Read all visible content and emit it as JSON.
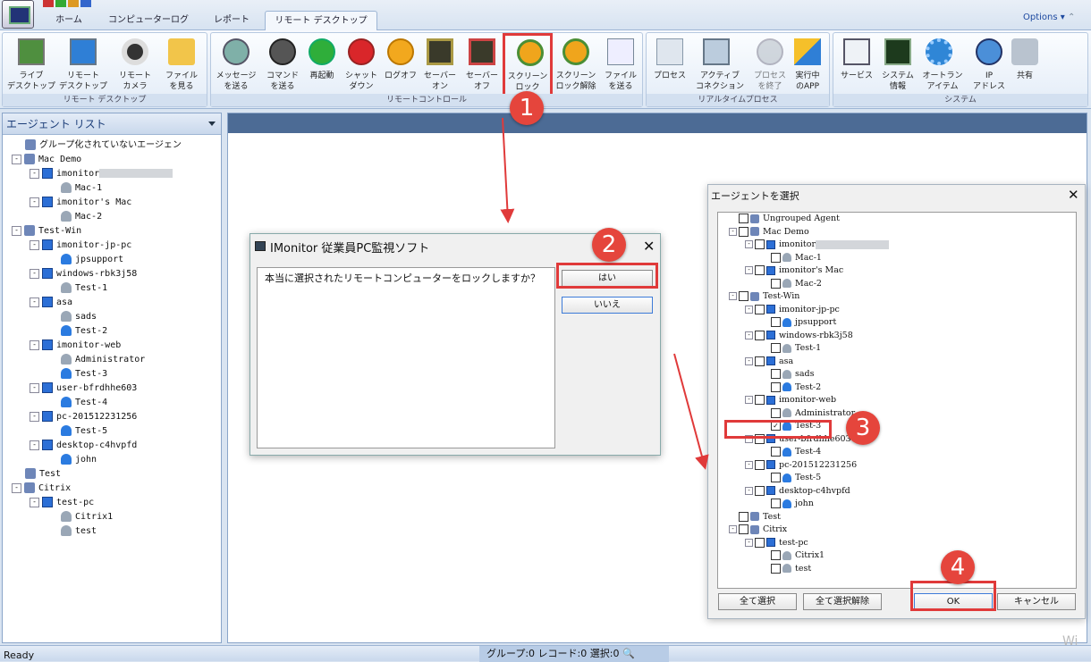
{
  "tabs": [
    "ホーム",
    "コンピューターログ",
    "レポート",
    "リモート デスクトップ"
  ],
  "options_label": "Options",
  "ribbon": {
    "groups": [
      {
        "title": "リモート デスクトップ",
        "buttons": [
          {
            "label": "ライブ\nデスクトップ",
            "icon": "monitor-icon"
          },
          {
            "label": "リモート\nデスクトップ",
            "icon": "remote-desktop-icon"
          },
          {
            "label": "リモート\nカメラ",
            "icon": "webcam-icon"
          },
          {
            "label": "ファイル\nを見る",
            "icon": "folder-icon"
          }
        ]
      },
      {
        "title": "リモートコントロール",
        "buttons": [
          {
            "label": "メッセージ\nを送る",
            "icon": "message-icon"
          },
          {
            "label": "コマンド\nを送る",
            "icon": "command-icon"
          },
          {
            "label": "再起動",
            "icon": "restart-icon"
          },
          {
            "label": "シャット\nダウン",
            "icon": "power-icon"
          },
          {
            "label": "ログオフ",
            "icon": "key-icon"
          },
          {
            "label": "セーバー\nオン",
            "icon": "screensaver-on-icon"
          },
          {
            "label": "セーバー\nオフ",
            "icon": "screensaver-off-icon"
          },
          {
            "label": "スクリーン\nロック",
            "icon": "screen-lock-icon"
          },
          {
            "label": "スクリーン\nロック解除",
            "icon": "screen-unlock-icon"
          },
          {
            "label": "ファイル\nを送る",
            "icon": "send-file-icon"
          }
        ]
      },
      {
        "title": "リアルタイムプロセス",
        "buttons": [
          {
            "label": "プロセス",
            "icon": "process-icon"
          },
          {
            "label": "アクティブ\nコネクション",
            "icon": "network-icon"
          },
          {
            "label": "プロセス\nを終了",
            "icon": "kill-process-icon"
          },
          {
            "label": "実行中\nのAPP",
            "icon": "apps-icon"
          }
        ]
      },
      {
        "title": "システム",
        "buttons": [
          {
            "label": "サービス",
            "icon": "services-icon"
          },
          {
            "label": "システム\n情報",
            "icon": "system-info-icon"
          },
          {
            "label": "オートラン\nアイテム",
            "icon": "gear-icon"
          },
          {
            "label": "IP\nアドレス",
            "icon": "ip-icon"
          },
          {
            "label": "共有",
            "icon": "share-icon"
          }
        ]
      }
    ]
  },
  "agent_panel": {
    "title": "エージェント リスト",
    "tree": [
      {
        "level": 0,
        "type": "grp",
        "text": "グループ化されていないエージェン",
        "toggle": ""
      },
      {
        "level": 0,
        "type": "grp",
        "text": "Mac Demo",
        "toggle": "-"
      },
      {
        "level": 1,
        "type": "pc",
        "text": "imonitor",
        "toggle": "-",
        "blur": true
      },
      {
        "level": 2,
        "type": "usr",
        "text": "Mac-1",
        "toggle": ""
      },
      {
        "level": 1,
        "type": "pc",
        "text": "imonitor's Mac",
        "toggle": "-"
      },
      {
        "level": 2,
        "type": "usr",
        "text": "Mac-2",
        "toggle": ""
      },
      {
        "level": 0,
        "type": "grp",
        "text": "Test-Win",
        "toggle": "-"
      },
      {
        "level": 1,
        "type": "pc",
        "text": "imonitor-jp-pc",
        "toggle": "-"
      },
      {
        "level": 2,
        "type": "usr on",
        "text": "jpsupport",
        "toggle": ""
      },
      {
        "level": 1,
        "type": "pc",
        "text": "windows-rbk3j58",
        "toggle": "-"
      },
      {
        "level": 2,
        "type": "usr",
        "text": "Test-1",
        "toggle": ""
      },
      {
        "level": 1,
        "type": "pc",
        "text": "asa",
        "toggle": "-"
      },
      {
        "level": 2,
        "type": "usr",
        "text": "sads",
        "toggle": ""
      },
      {
        "level": 2,
        "type": "usr on",
        "text": "Test-2",
        "toggle": ""
      },
      {
        "level": 1,
        "type": "pc",
        "text": "imonitor-web",
        "toggle": "-"
      },
      {
        "level": 2,
        "type": "usr",
        "text": "Administrator",
        "toggle": ""
      },
      {
        "level": 2,
        "type": "usr on",
        "text": "Test-3",
        "toggle": ""
      },
      {
        "level": 1,
        "type": "pc",
        "text": "user-bfrdhhe603",
        "toggle": "-"
      },
      {
        "level": 2,
        "type": "usr on",
        "text": "Test-4",
        "toggle": ""
      },
      {
        "level": 1,
        "type": "pc",
        "text": "pc-201512231256",
        "toggle": "-"
      },
      {
        "level": 2,
        "type": "usr on",
        "text": "Test-5",
        "toggle": ""
      },
      {
        "level": 1,
        "type": "pc",
        "text": "desktop-c4hvpfd",
        "toggle": "-"
      },
      {
        "level": 2,
        "type": "usr on",
        "text": "john",
        "toggle": ""
      },
      {
        "level": 0,
        "type": "grp",
        "text": "Test",
        "toggle": ""
      },
      {
        "level": 0,
        "type": "grp",
        "text": "Citrix",
        "toggle": "-"
      },
      {
        "level": 1,
        "type": "pc",
        "text": "test-pc",
        "toggle": "-"
      },
      {
        "level": 2,
        "type": "usr",
        "text": "Citrix1",
        "toggle": ""
      },
      {
        "level": 2,
        "type": "usr",
        "text": "test",
        "toggle": ""
      }
    ]
  },
  "confirm_dialog": {
    "title": "IMonitor 従業員PC監視ソフト",
    "message": "本当に選択されたリモートコンピューターをロックしますか？",
    "yes": "はい",
    "no": "いいえ"
  },
  "select_dialog": {
    "title": "エージェントを選択",
    "tree": [
      {
        "level": 0,
        "type": "grp",
        "text": "Ungrouped Agent",
        "toggle": "",
        "checked": false
      },
      {
        "level": 0,
        "type": "grp",
        "text": "Mac Demo",
        "toggle": "-",
        "checked": false
      },
      {
        "level": 1,
        "type": "pc",
        "text": "imonitor",
        "toggle": "-",
        "checked": false,
        "blur": true
      },
      {
        "level": 2,
        "type": "usr",
        "text": "Mac-1",
        "toggle": "",
        "checked": false
      },
      {
        "level": 1,
        "type": "pc",
        "text": "imonitor's Mac",
        "toggle": "-",
        "checked": false
      },
      {
        "level": 2,
        "type": "usr",
        "text": "Mac-2",
        "toggle": "",
        "checked": false
      },
      {
        "level": 0,
        "type": "grp",
        "text": "Test-Win",
        "toggle": "-",
        "checked": false
      },
      {
        "level": 1,
        "type": "pc",
        "text": "imonitor-jp-pc",
        "toggle": "-",
        "checked": false
      },
      {
        "level": 2,
        "type": "usr on",
        "text": "jpsupport",
        "toggle": "",
        "checked": false
      },
      {
        "level": 1,
        "type": "pc",
        "text": "windows-rbk3j58",
        "toggle": "-",
        "checked": false
      },
      {
        "level": 2,
        "type": "usr",
        "text": "Test-1",
        "toggle": "",
        "checked": false
      },
      {
        "level": 1,
        "type": "pc",
        "text": "asa",
        "toggle": "-",
        "checked": false
      },
      {
        "level": 2,
        "type": "usr",
        "text": "sads",
        "toggle": "",
        "checked": false
      },
      {
        "level": 2,
        "type": "usr on",
        "text": "Test-2",
        "toggle": "",
        "checked": false
      },
      {
        "level": 1,
        "type": "pc",
        "text": "imonitor-web",
        "toggle": "-",
        "checked": false
      },
      {
        "level": 2,
        "type": "usr",
        "text": "Administrator",
        "toggle": "",
        "checked": false
      },
      {
        "level": 2,
        "type": "usr on",
        "text": "Test-3",
        "toggle": "",
        "checked": true
      },
      {
        "level": 1,
        "type": "pc",
        "text": "user-bfrdhhe603",
        "toggle": "-",
        "checked": false
      },
      {
        "level": 2,
        "type": "usr on",
        "text": "Test-4",
        "toggle": "",
        "checked": false
      },
      {
        "level": 1,
        "type": "pc",
        "text": "pc-201512231256",
        "toggle": "-",
        "checked": false
      },
      {
        "level": 2,
        "type": "usr on",
        "text": "Test-5",
        "toggle": "",
        "checked": false
      },
      {
        "level": 1,
        "type": "pc",
        "text": "desktop-c4hvpfd",
        "toggle": "-",
        "checked": false
      },
      {
        "level": 2,
        "type": "usr on",
        "text": "john",
        "toggle": "",
        "checked": false
      },
      {
        "level": 0,
        "type": "grp",
        "text": "Test",
        "toggle": "",
        "checked": false
      },
      {
        "level": 0,
        "type": "grp",
        "text": "Citrix",
        "toggle": "-",
        "checked": false
      },
      {
        "level": 1,
        "type": "pc",
        "text": "test-pc",
        "toggle": "-",
        "checked": false
      },
      {
        "level": 2,
        "type": "usr",
        "text": "Citrix1",
        "toggle": "",
        "checked": false
      },
      {
        "level": 2,
        "type": "usr",
        "text": "test",
        "toggle": "",
        "checked": false
      }
    ],
    "select_all": "全て選択",
    "deselect_all": "全て選択解除",
    "ok": "OK",
    "cancel": "キャンセル"
  },
  "status": {
    "ready": "Ready",
    "summary": "グループ:0 レコード:0 選択:0"
  },
  "callouts": [
    "1",
    "2",
    "3",
    "4"
  ],
  "colors": {
    "highlight": "#e03a3a",
    "callout": "#e5453c"
  }
}
